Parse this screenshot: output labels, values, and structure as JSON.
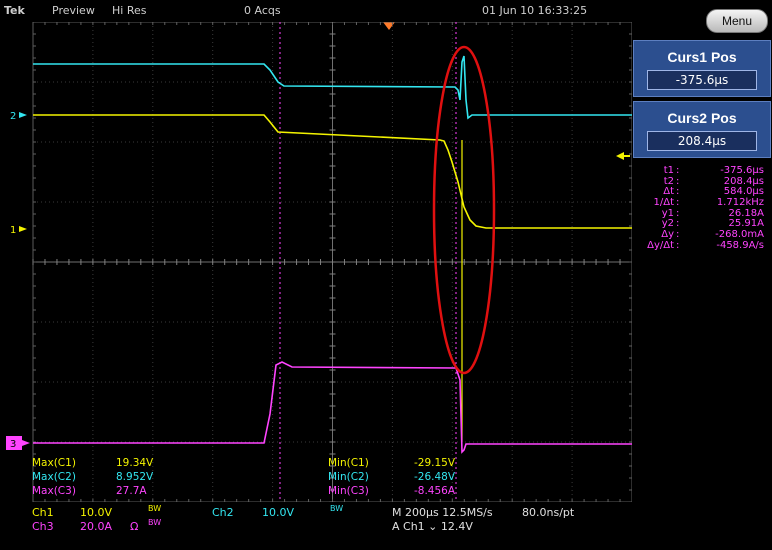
{
  "topbar": {
    "brand": "Tek",
    "mode": "Preview",
    "acq_mode": "Hi Res",
    "acqs": "0 Acqs",
    "datetime": "01 Jun 10 16:33:25"
  },
  "menu_label": "Menu",
  "cursor1": {
    "title": "Curs1 Pos",
    "value": "-375.6µs"
  },
  "cursor2": {
    "title": "Curs2 Pos",
    "value": "208.4µs"
  },
  "readouts": [
    {
      "key": "t1",
      "value": "-375.6µs"
    },
    {
      "key": "t2",
      "value": "208.4µs"
    },
    {
      "key": "Δt",
      "value": "584.0µs"
    },
    {
      "key": "1/Δt",
      "value": "1.712kHz"
    },
    {
      "key": "y1",
      "value": "26.18A"
    },
    {
      "key": "y2",
      "value": "25.91A"
    },
    {
      "key": "Δy",
      "value": "-268.0mA"
    },
    {
      "key": "Δy/Δt",
      "value": "-458.9A/s"
    }
  ],
  "markers": {
    "ch2": "2",
    "ch1": "1",
    "ch3": "3"
  },
  "measurements": {
    "max_c1_label": "Max(C1)",
    "max_c1": "19.34V",
    "max_c2_label": "Max(C2)",
    "max_c2": "8.952V",
    "max_c3_label": "Max(C3)",
    "max_c3": "27.7A",
    "min_c1_label": "Min(C1)",
    "min_c1": "-29.15V",
    "min_c2_label": "Min(C2)",
    "min_c2": "-26.48V",
    "min_c3_label": "Min(C3)",
    "min_c3": "-8.456A"
  },
  "channels": {
    "ch1_label": "Ch1",
    "ch1_scale": "10.0V",
    "ch1_bw": "BW",
    "ch2_label": "Ch2",
    "ch2_scale": "10.0V",
    "ch2_bw": "BW",
    "ch3_label": "Ch3",
    "ch3_scale": "20.0A",
    "ch3_omega": "Ω",
    "ch3_bw": "BW"
  },
  "timebase": {
    "line1": "M 200µs 12.5MS/s",
    "resolution": "80.0ns/pt",
    "trigger": "A  Ch1  ⌄  12.4V"
  },
  "colors": {
    "ch1": "#f4f400",
    "ch2": "#33e6f0",
    "ch3": "#ff44ff",
    "annotation": "#e01010",
    "cursor_panel": "#2c4f8f"
  },
  "icons": [
    "trigger-position-icon",
    "ch1-ground-icon",
    "ch2-ground-icon",
    "ch3-ground-icon",
    "trigger-level-icon"
  ]
}
